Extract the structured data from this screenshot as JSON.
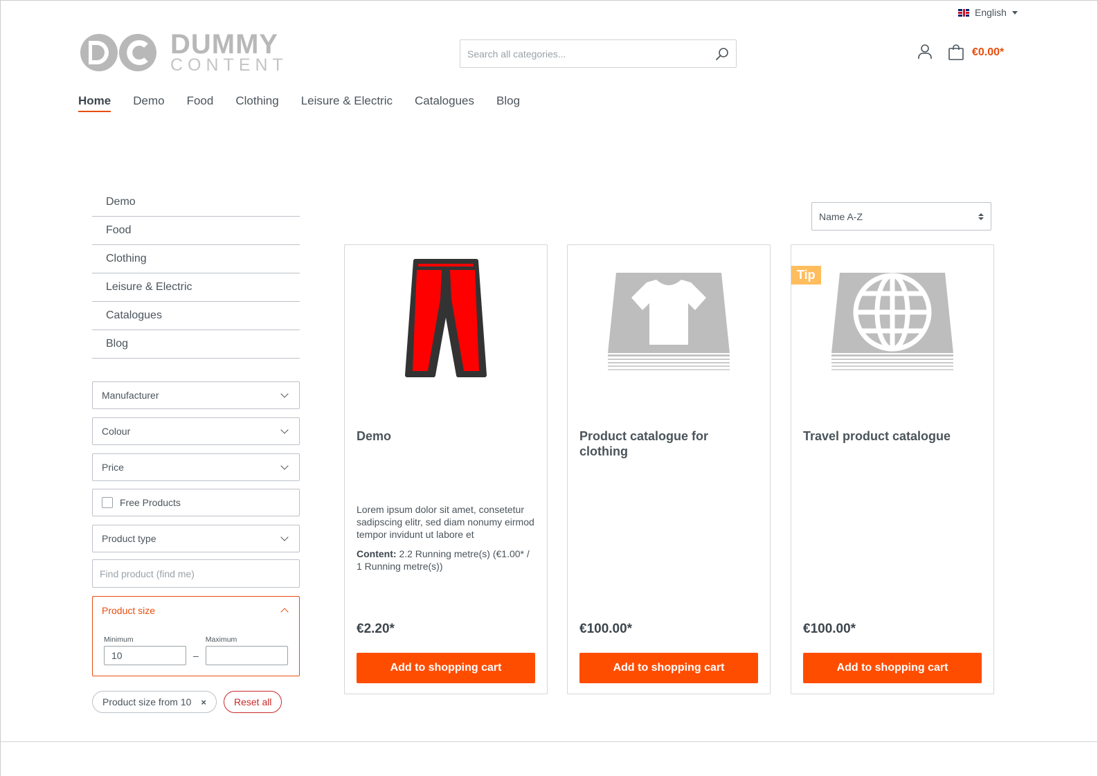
{
  "language": {
    "label": "English",
    "flag": "uk-flag-icon"
  },
  "logo": {
    "line1": "DUMMY",
    "line2": "CONTENT"
  },
  "search": {
    "placeholder": "Search all categories..."
  },
  "cart": {
    "total": "€0.00*"
  },
  "main_nav": [
    {
      "label": "Home",
      "active": true
    },
    {
      "label": "Demo"
    },
    {
      "label": "Food"
    },
    {
      "label": "Clothing"
    },
    {
      "label": "Leisure & Electric"
    },
    {
      "label": "Catalogues"
    },
    {
      "label": "Blog"
    }
  ],
  "sidebar": {
    "categories": [
      {
        "label": "Demo"
      },
      {
        "label": "Food"
      },
      {
        "label": "Clothing"
      },
      {
        "label": "Leisure & Electric"
      },
      {
        "label": "Catalogues"
      },
      {
        "label": "Blog"
      }
    ],
    "filters": {
      "manufacturer": "Manufacturer",
      "colour": "Colour",
      "price": "Price",
      "free_products": "Free Products",
      "product_type": "Product type",
      "find_product_placeholder": "Find product (find me)",
      "product_size": {
        "label": "Product size",
        "min_label": "Minimum",
        "max_label": "Maximum",
        "min_value": "10",
        "max_value": "",
        "dash": "–"
      }
    },
    "active_filters": {
      "chip": "Product size from 10",
      "remove": "×",
      "reset": "Reset all"
    }
  },
  "sorting": {
    "selected": "Name A-Z"
  },
  "products": [
    {
      "name": "Demo",
      "image": "red-trousers-image",
      "description": "Lorem ipsum dolor sit amet, consetetur sadipscing elitr, sed diam nonumy eirmod tempor invidunt ut labore et",
      "content_label": "Content:",
      "content_value": "2.2 Running metre(s) (€1.00* / 1 Running metre(s))",
      "price": "€2.20*",
      "button": "Add to shopping cart"
    },
    {
      "name": "Product catalogue for clothing",
      "image": "tshirt-catalogue-icon",
      "price": "€100.00*",
      "button": "Add to shopping cart"
    },
    {
      "name": "Travel product catalogue",
      "image": "globe-catalogue-icon",
      "badge": "Tip",
      "price": "€100.00*",
      "button": "Add to shopping cart"
    }
  ],
  "colors": {
    "accent": "#ff4d00",
    "price_header": "#e84d0e",
    "badge": "#ffbd5d"
  }
}
